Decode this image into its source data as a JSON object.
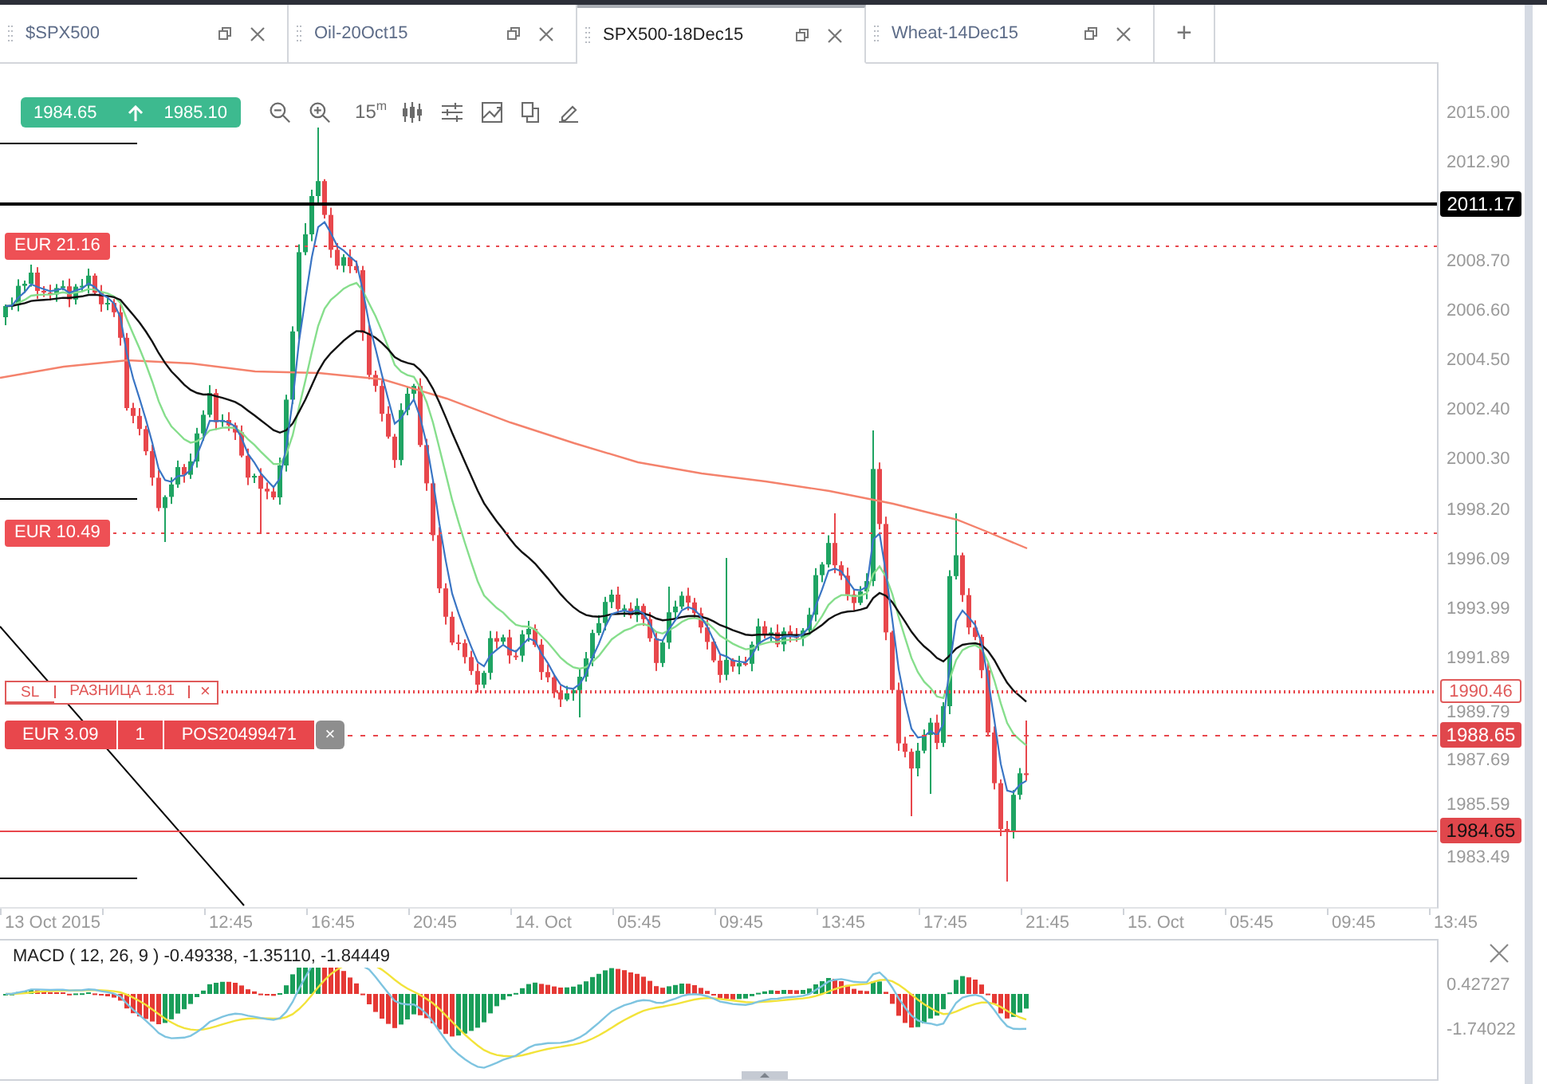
{
  "tabs": [
    {
      "label": "$SPX500",
      "selected": false
    },
    {
      "label": "Oil-20Oct15",
      "selected": false
    },
    {
      "label": "SPX500-18Dec15",
      "selected": true
    },
    {
      "label": "Wheat-14Dec15",
      "selected": false
    }
  ],
  "new_tab_button": "+",
  "toolbar": {
    "quote": {
      "bid": "1984.65",
      "ask": "1985.10"
    },
    "interval": "15$^{m}$"
  },
  "price_axis": {
    "ticks": [
      "2015.00",
      "2012.90",
      "2008.70",
      "2006.60",
      "2004.50",
      "2002.40",
      "2000.30",
      "1998.20",
      "1996.09",
      "1993.99",
      "1991.89",
      "1989.79",
      "1987.69",
      "1985.59",
      "1983.49"
    ]
  },
  "price_lines": [
    {
      "kind": "alert",
      "axis_tag": "2011.17"
    },
    {
      "kind": "order",
      "tags": [
        "EUR 21.16"
      ]
    },
    {
      "kind": "order",
      "tags": [
        "EUR 10.49"
      ]
    },
    {
      "kind": "stop-loss",
      "tags": [
        "SL",
        "РАЗНИЦА 1.81"
      ],
      "close": "×",
      "axis_tag": "1990.46"
    },
    {
      "kind": "position",
      "tags": [
        "EUR 3.09",
        "1",
        "POS20499471"
      ],
      "close": "×",
      "axis_tag": "1988.65"
    },
    {
      "kind": "last-price",
      "axis_tag": "1984.65"
    }
  ],
  "time_axis": {
    "labels": [
      "13 Oct 2015",
      "12:45",
      "16:45",
      "20:45",
      "14. Oct",
      "05:45",
      "09:45",
      "13:45",
      "17:45",
      "21:45",
      "15. Oct",
      "05:45",
      "09:45",
      "13:45"
    ]
  },
  "macd_panel": {
    "title": "MACD ( 12, 26, 9 ) -0.49338, -1.35110, -1.84449",
    "axis": [
      "0.42727",
      "-1.74022"
    ]
  }
}
